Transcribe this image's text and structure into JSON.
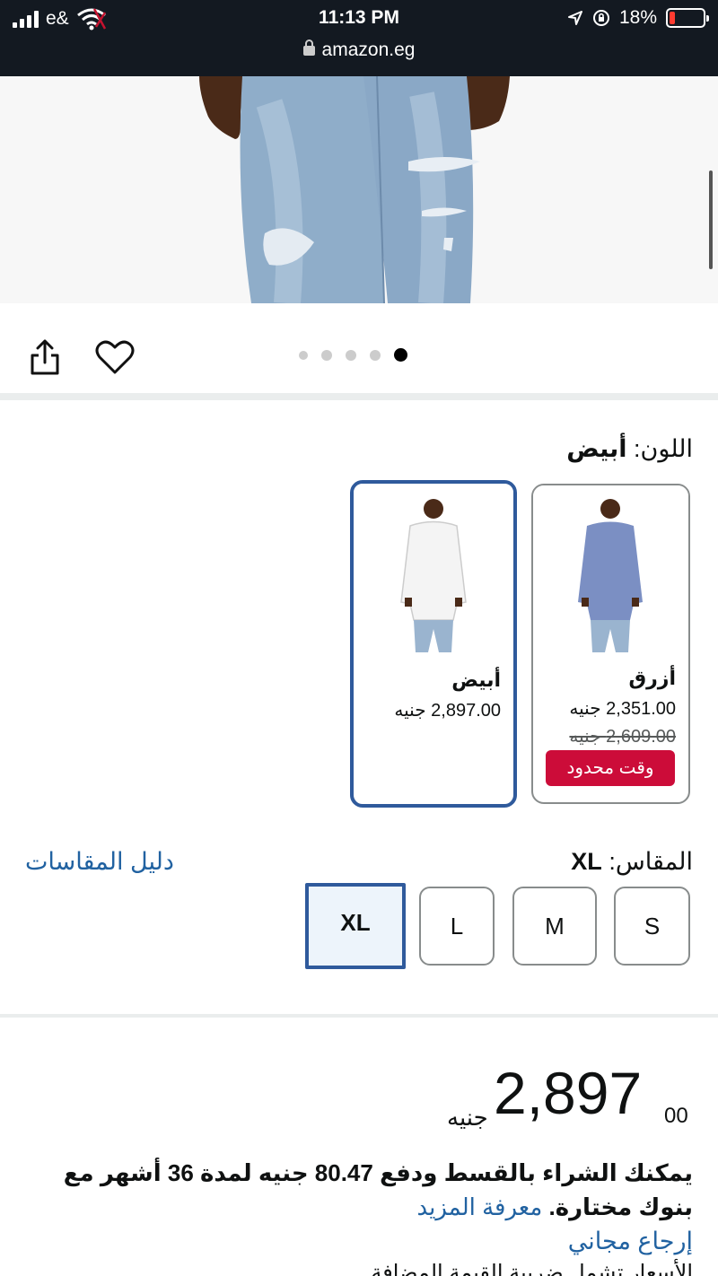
{
  "status_bar": {
    "carrier": "e&",
    "time": "11:13 PM",
    "battery": "18%",
    "url": "amazon.eg"
  },
  "gallery": {
    "total_images": 5,
    "active_index": 5
  },
  "color": {
    "label": "اللون:",
    "selected": "أبيض",
    "options": [
      {
        "name": "أزرق",
        "price": "2,351.00 جنيه",
        "old_price": "2,609.00 جنيه",
        "badge": "وقت محدود"
      },
      {
        "name": "أبيض",
        "price": "2,897.00 جنيه"
      }
    ]
  },
  "size": {
    "label": "المقاس:",
    "selected": "XL",
    "guide_link": "دليل المقاسات",
    "options": [
      "S",
      "M",
      "L",
      "XL"
    ]
  },
  "price": {
    "currency": "جنيه",
    "whole": "2,897",
    "fraction": "00"
  },
  "installment": {
    "text": "يمكنك الشراء بالقسط ودفع 80.47 جنيه لمدة 36 أشهر مع بنوك مختارة.",
    "link": "معرفة المزيد"
  },
  "free_return": "إرجاع مجاني",
  "partial_line": "الأسعار تشمل ضريبة القيمة المضافة"
}
